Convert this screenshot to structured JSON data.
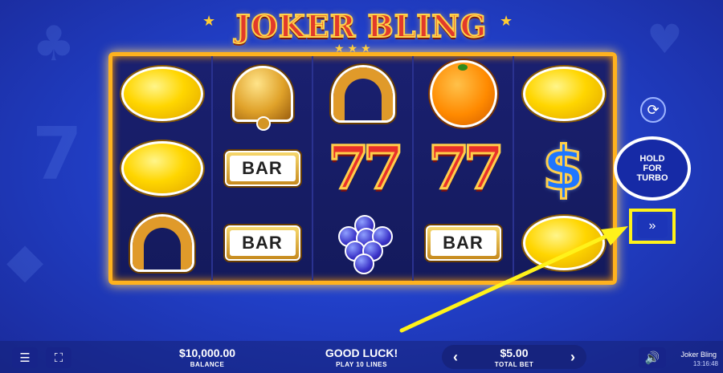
{
  "game": {
    "logo_text": "JOKER BLING",
    "name": "Joker Bling",
    "time": "13:16:48"
  },
  "reels": [
    [
      "lemon",
      "lemon",
      "horseshoe"
    ],
    [
      "bell",
      "bar",
      "bar"
    ],
    [
      "horseshoe",
      "seven",
      "grapes"
    ],
    [
      "orange",
      "seven",
      "bar"
    ],
    [
      "lemon",
      "dollar",
      "lemon"
    ]
  ],
  "symbols": {
    "bar_label": "BAR",
    "seven_label": "77",
    "dollar_label": "$"
  },
  "controls": {
    "spin_label": "HOLD FOR TURBO",
    "autoplay_icon": "autoplay-icon",
    "turbo_icon": "fast-forward-icon",
    "menu_icon": "hamburger-menu-icon",
    "fullscreen_icon": "fullscreen-icon",
    "sound_icon": "speaker-icon"
  },
  "balance": {
    "value": "$10,000.00",
    "label": "BALANCE"
  },
  "message": {
    "value": "GOOD LUCK!",
    "label": "PLAY 10 LINES"
  },
  "bet": {
    "value": "$5.00",
    "label": "TOTAL BET",
    "decrease": "‹",
    "increase": "›"
  },
  "colors": {
    "frame": "#ffb21e",
    "highlight": "#fff21a",
    "background": "#2140c9"
  }
}
